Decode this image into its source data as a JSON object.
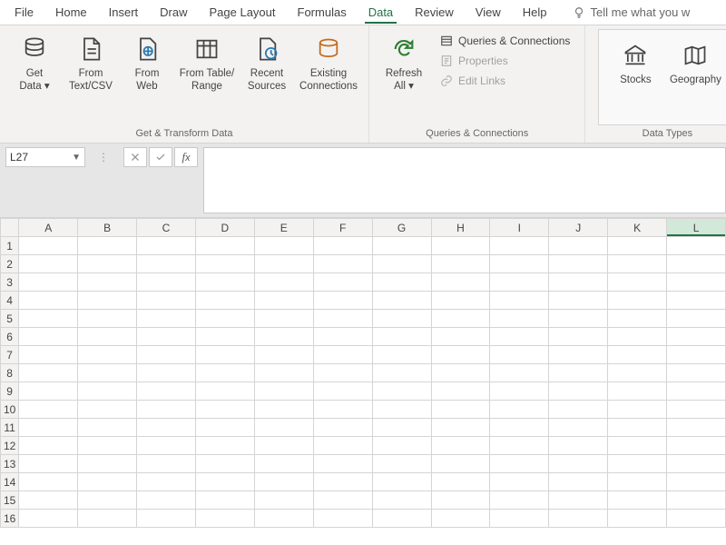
{
  "tabs": {
    "file": "File",
    "home": "Home",
    "insert": "Insert",
    "draw": "Draw",
    "page_layout": "Page Layout",
    "formulas": "Formulas",
    "data": "Data",
    "review": "Review",
    "view": "View",
    "help": "Help"
  },
  "tellme_placeholder": "Tell me what you w",
  "ribbon": {
    "get_transform": {
      "label": "Get & Transform Data",
      "get_data": "Get\nData",
      "from_textcsv": "From\nText/CSV",
      "from_web": "From\nWeb",
      "from_table_range": "From Table/\nRange",
      "recent_sources": "Recent\nSources",
      "existing_connections": "Existing\nConnections"
    },
    "queries": {
      "label": "Queries & Connections",
      "refresh_all": "Refresh\nAll",
      "queries_connections": "Queries & Connections",
      "properties": "Properties",
      "edit_links": "Edit Links"
    },
    "data_types": {
      "label": "Data Types",
      "stocks": "Stocks",
      "geography": "Geography"
    }
  },
  "namebox_value": "L27",
  "columns": [
    "A",
    "B",
    "C",
    "D",
    "E",
    "F",
    "G",
    "H",
    "I",
    "J",
    "K",
    "L"
  ],
  "selected_column": "L",
  "rows": [
    "1",
    "2",
    "3",
    "4",
    "5",
    "6",
    "7",
    "8",
    "9",
    "10",
    "11",
    "12",
    "13",
    "14",
    "15",
    "16"
  ]
}
